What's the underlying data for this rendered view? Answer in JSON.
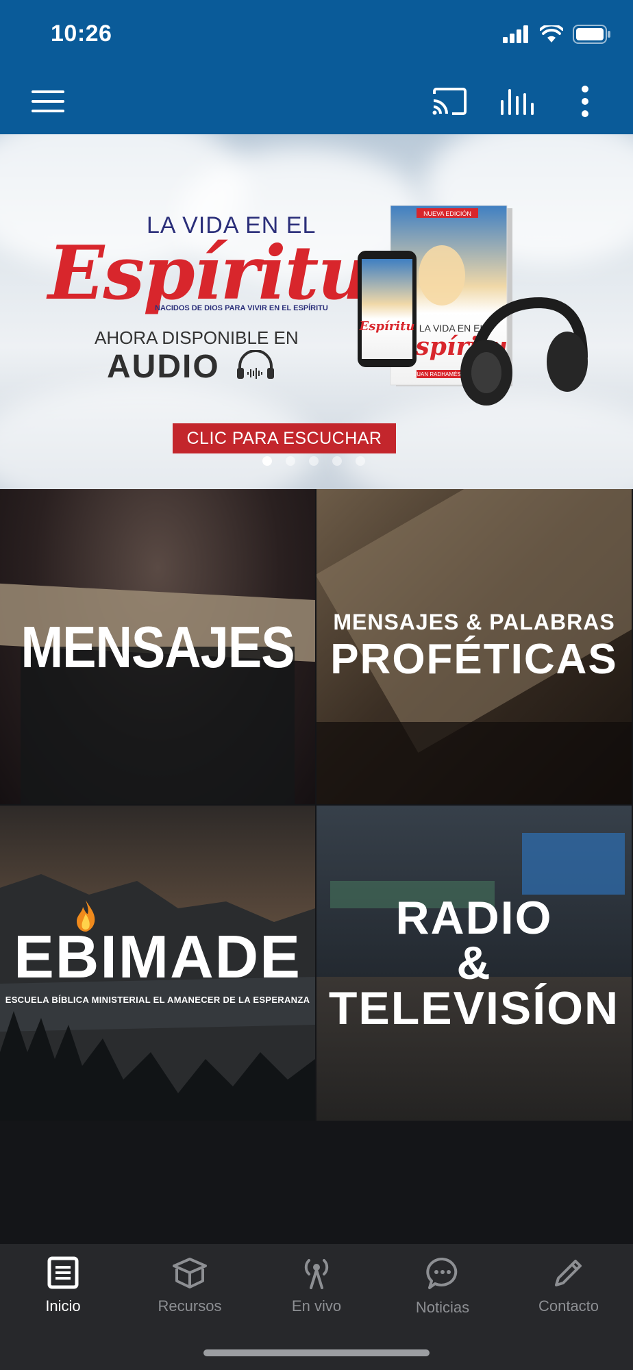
{
  "status_bar": {
    "time": "10:26"
  },
  "banner": {
    "line1": "LA VIDA EN EL",
    "script_title": "Espíritu",
    "subtitle": "NACIDOS DE DIOS PARA VIVIR EN EL ESPÍRITU",
    "line3": "AHORA DISPONIBLE EN",
    "line4": "AUDIO",
    "cta": "CLIC PARA ESCUCHAR",
    "book_badge": "NUEVA EDICIÓN",
    "book_title": "LA VIDA EN EL",
    "book_script": "Espíritu",
    "book_author": "JUAN RADHAMÉS FERNÁNDEZ",
    "slide_count": 5,
    "active_slide": 1
  },
  "tiles": [
    {
      "title": "MENSAJES"
    },
    {
      "title_top": "MENSAJES & PALABRAS",
      "title_bottom": "PROFÉTICAS"
    },
    {
      "title": "EBIMADE",
      "subtitle": "ESCUELA BÍBLICA MINISTERIAL EL AMANECER DE LA ESPERANZA"
    },
    {
      "line1": "RADIO",
      "line2": "&",
      "line3": "TELEVISÍON"
    }
  ],
  "bottom_nav": [
    {
      "label": "Inicio",
      "icon": "home-icon",
      "active": true
    },
    {
      "label": "Recursos",
      "icon": "box-icon",
      "active": false
    },
    {
      "label": "En vivo",
      "icon": "broadcast-icon",
      "active": false
    },
    {
      "label": "Noticias",
      "icon": "chat-icon",
      "active": false
    },
    {
      "label": "Contacto",
      "icon": "pencil-icon",
      "active": false
    }
  ],
  "colors": {
    "app_bar": "#0a5b99",
    "banner_red": "#c3262c",
    "nav_bg": "#27282b",
    "page_bg": "#141518"
  }
}
